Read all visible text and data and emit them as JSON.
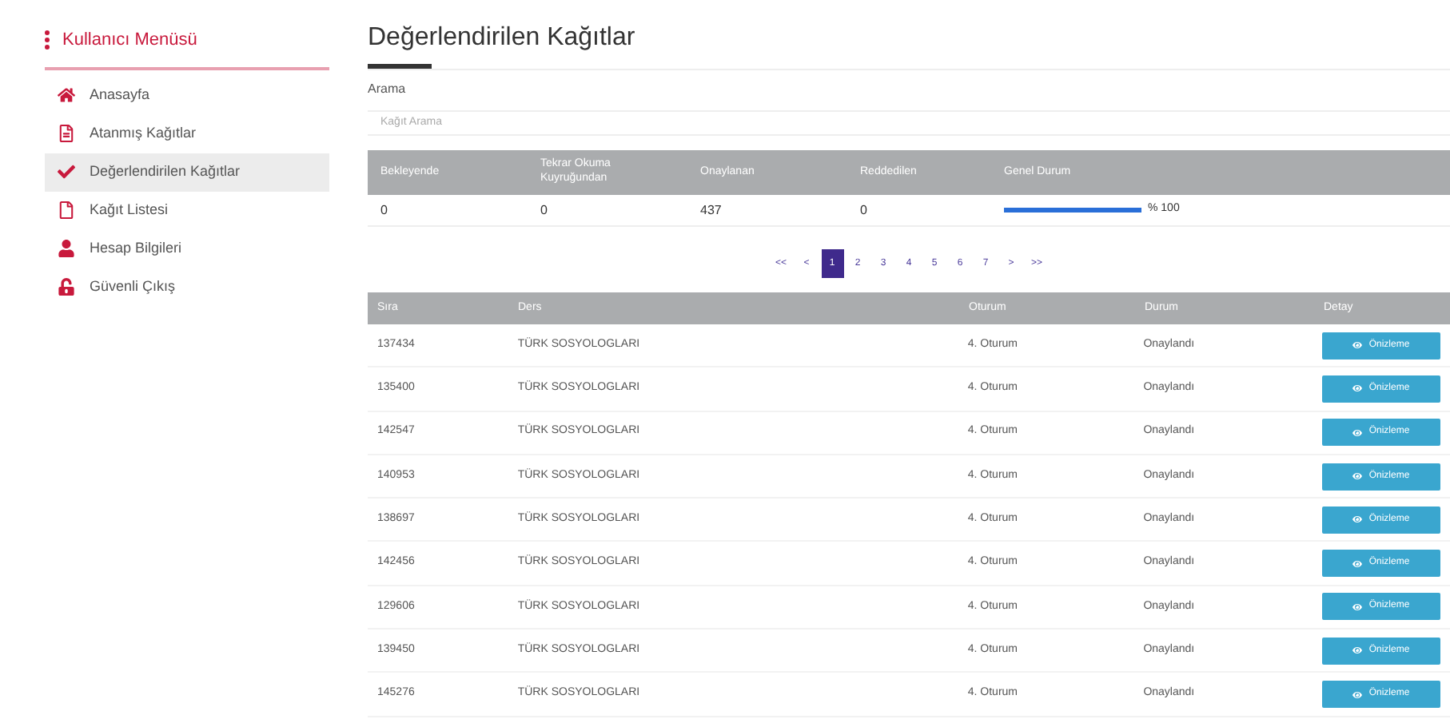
{
  "sidebar": {
    "title": "Kullanıcı Menüsü",
    "items": [
      {
        "label": "Anasayfa",
        "kind": "home",
        "selected": false
      },
      {
        "label": "Atanmış Kağıtlar",
        "kind": "doc",
        "selected": false
      },
      {
        "label": "Değerlendirilen Kağıtlar",
        "kind": "check",
        "selected": true
      },
      {
        "label": "Kağıt Listesi",
        "kind": "file",
        "selected": false
      },
      {
        "label": "Hesap Bilgileri",
        "kind": "user",
        "selected": false
      },
      {
        "label": "Güvenli Çıkış",
        "kind": "lock",
        "selected": false
      }
    ]
  },
  "page_title": "Değerlendirilen Kağıtlar",
  "search": {
    "label": "Arama",
    "placeholder": "Kağıt Arama"
  },
  "summary": {
    "columns": [
      "Bekleyende",
      "Tekrar Okuma Kuyruğundan",
      "Onaylanan",
      "Reddedilen",
      "Genel Durum"
    ],
    "values": [
      "0",
      "0",
      "437",
      "0"
    ],
    "progress": {
      "level": 1,
      "reading": "% 100"
    }
  },
  "pagination": [
    {
      "label": "<<",
      "selected": false
    },
    {
      "label": "<",
      "selected": false
    },
    {
      "label": "1",
      "selected": true
    },
    {
      "label": "2",
      "selected": false
    },
    {
      "label": "3",
      "selected": false
    },
    {
      "label": "4",
      "selected": false
    },
    {
      "label": "5",
      "selected": false
    },
    {
      "label": "6",
      "selected": false
    },
    {
      "label": "7",
      "selected": false
    },
    {
      "label": ">",
      "selected": false
    },
    {
      "label": ">>",
      "selected": false
    }
  ],
  "table": {
    "columns": [
      "Sıra",
      "Ders",
      "Oturum",
      "Durum",
      "Detay"
    ],
    "rows": [
      [
        "137434",
        "TÜRK SOSYOLOGLARI",
        "4. Oturum",
        "Onaylandı",
        "Önizleme"
      ],
      [
        "135400",
        "TÜRK SOSYOLOGLARI",
        "4. Oturum",
        "Onaylandı",
        "Önizleme"
      ],
      [
        "142547",
        "TÜRK SOSYOLOGLARI",
        "4. Oturum",
        "Onaylandı",
        "Önizleme"
      ],
      [
        "140953",
        "TÜRK SOSYOLOGLARI",
        "4. Oturum",
        "Onaylandı",
        "Önizleme"
      ],
      [
        "138697",
        "TÜRK SOSYOLOGLARI",
        "4. Oturum",
        "Onaylandı",
        "Önizleme"
      ],
      [
        "142456",
        "TÜRK SOSYOLOGLARI",
        "4. Oturum",
        "Onaylandı",
        "Önizleme"
      ],
      [
        "129606",
        "TÜRK SOSYOLOGLARI",
        "4. Oturum",
        "Onaylandı",
        "Önizleme"
      ],
      [
        "139450",
        "TÜRK SOSYOLOGLARI",
        "4. Oturum",
        "Onaylandı",
        "Önizleme"
      ],
      [
        "145276",
        "TÜRK SOSYOLOGLARI",
        "4. Oturum",
        "Onaylandı",
        "Önizleme"
      ]
    ]
  }
}
